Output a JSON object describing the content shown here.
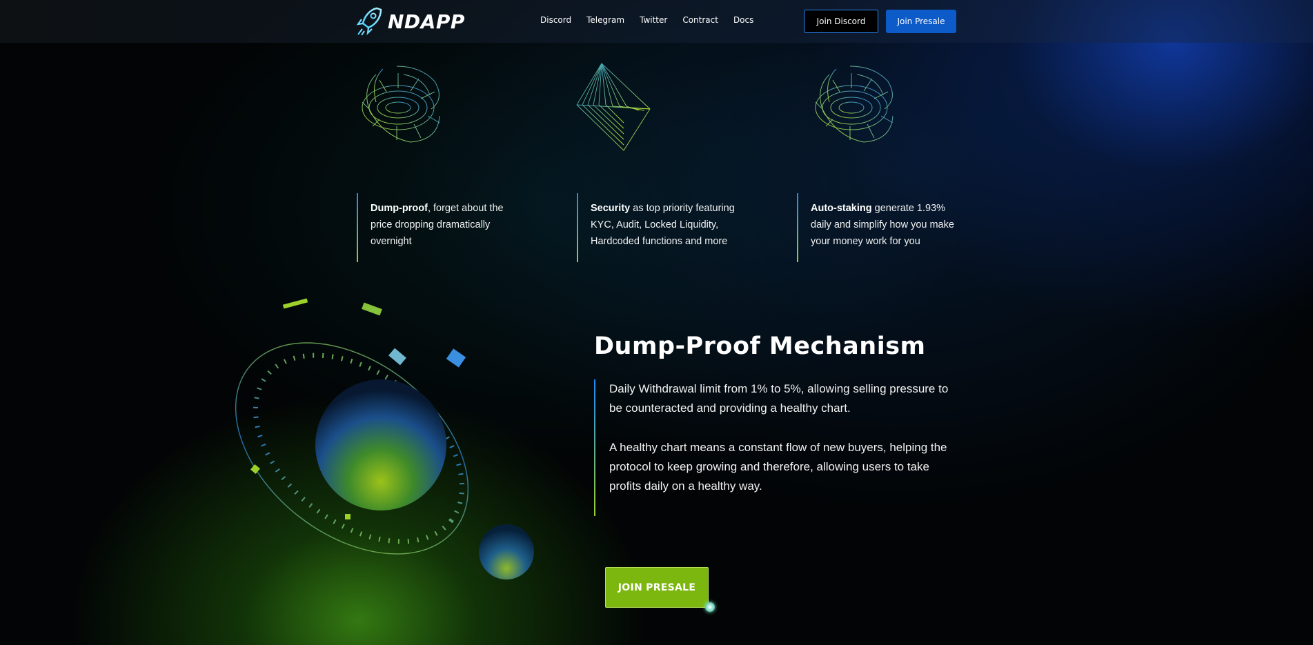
{
  "brand": {
    "name": "NDAPP",
    "logo_icon": "rocket-icon"
  },
  "nav": {
    "items": [
      {
        "label": "Discord"
      },
      {
        "label": "Telegram"
      },
      {
        "label": "Twitter"
      },
      {
        "label": "Contract"
      },
      {
        "label": "Docs"
      }
    ],
    "join_discord_label": "Join Discord",
    "join_presale_label": "Join Presale"
  },
  "features": [
    {
      "icon": "wireframe-torus-icon",
      "bold": "Dump-proof",
      "text": ", forget about the price dropping dramatically overnight"
    },
    {
      "icon": "wireframe-diamond-icon",
      "bold": "Security",
      "text": " as top priority featuring KYC, Audit, Locked Liquidity, Hardcoded functions and more"
    },
    {
      "icon": "wireframe-torus-icon",
      "bold": "Auto-staking",
      "text": " generate 1.93% daily and simplify how you make your money work for you"
    }
  ],
  "mechanism": {
    "title": "Dump-Proof Mechanism",
    "paragraphs": [
      "Daily Withdrawal limit from 1% to 5%, allowing selling pressure to be counteracted and providing a healthy chart.",
      "A healthy chart means a constant flow of new buyers, helping the protocol to keep growing and therefore, allowing users to take profits daily on a healthy way."
    ],
    "cta_label": "JOIN PRESALE"
  },
  "colors": {
    "accent_blue": "#0d5ac9",
    "accent_green": "#7cb70f",
    "border_blue": "#2d8bff"
  }
}
